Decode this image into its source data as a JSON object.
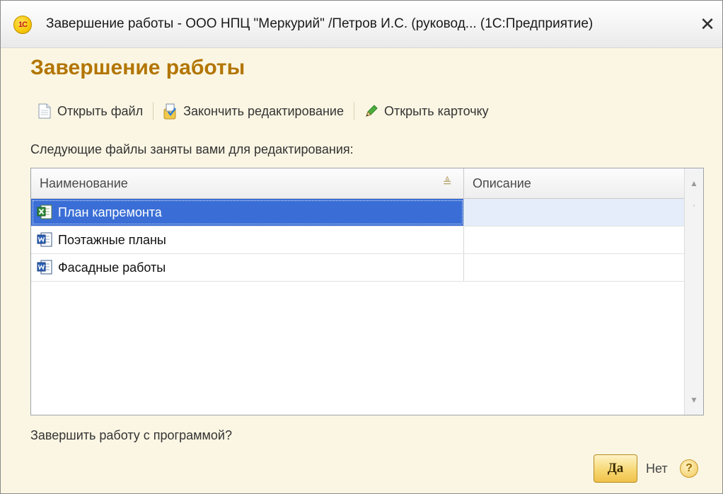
{
  "window": {
    "title": "Завершение работы - ООО НПЦ \"Меркурий\" /Петров И.С. (руковод... (1С:Предприятие)",
    "logo_text": "1С",
    "close_glyph": "✕"
  },
  "form": {
    "title": "Завершение работы",
    "prompt": "Следующие файлы заняты вами для редактирования:",
    "question": "Завершить работу с программой?"
  },
  "toolbar": {
    "open_file": "Открыть файл",
    "finish_editing": "Закончить редактирование",
    "open_card": "Открыть карточку"
  },
  "table": {
    "columns": {
      "name": "Наименование",
      "description": "Описание"
    },
    "rows": [
      {
        "name": "План капремонта",
        "description": "",
        "icon": "excel-file-icon",
        "selected": true
      },
      {
        "name": "Поэтажные планы",
        "description": "",
        "icon": "word-file-icon",
        "selected": false
      },
      {
        "name": "Фасадные работы",
        "description": "",
        "icon": "word-file-icon",
        "selected": false
      }
    ]
  },
  "buttons": {
    "yes": "Да",
    "no": "Нет",
    "help": "?"
  },
  "colors": {
    "form_background": "#faf6e3",
    "title_accent": "#b37500",
    "selection": "#3a6ed6"
  }
}
